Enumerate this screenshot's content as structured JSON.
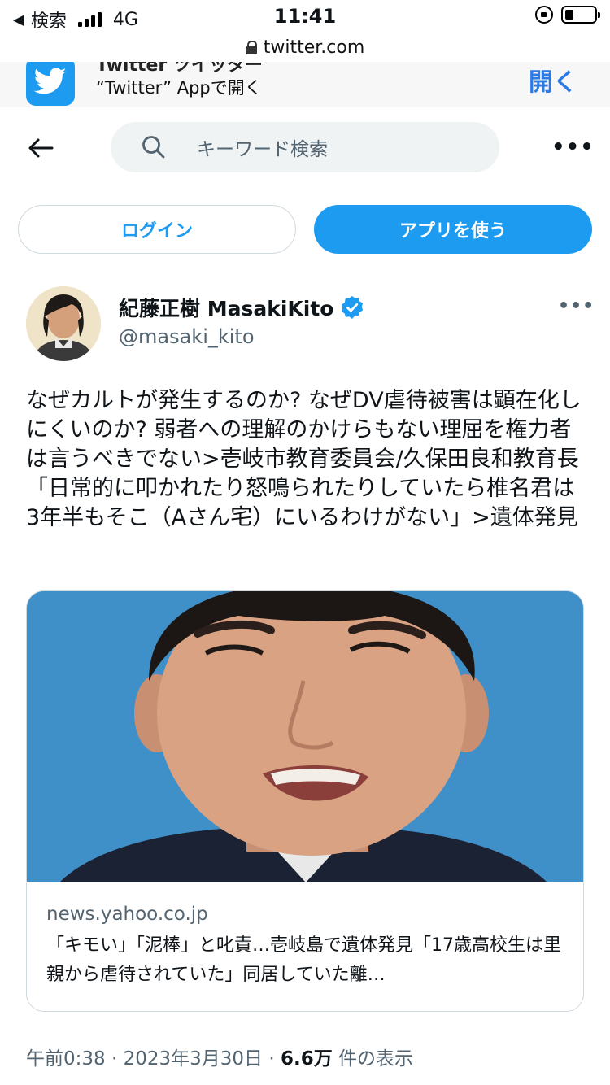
{
  "status_bar": {
    "back_label": "検索",
    "carrier": "4G",
    "time": "11:41"
  },
  "browser": {
    "url": "twitter.com"
  },
  "app_banner": {
    "title": "Twitter ツイッター",
    "subtitle": "“Twitter” Appで開く",
    "open_label": "開く"
  },
  "search": {
    "placeholder": "キーワード検索"
  },
  "actions": {
    "login_label": "ログイン",
    "use_app_label": "アプリを使う"
  },
  "tweet": {
    "author_name": "紀藤正樹 MasakiKito",
    "handle": "@masaki_kito",
    "text": "なぜカルトが発生するのか? なぜDV虐待被害は顕在化しにくいのか? 弱者への理解のかけらもない理屈を権力者は言うべきでない>壱岐市教育委員会/久保田良和教育長「日常的に叩かれたり怒鳴られたりしていたら椎名君は3年半もそこ（Aさん宅）にいるわけがない」>遺体発見",
    "card": {
      "domain": "news.yahoo.co.jp",
      "title": "「キモい」「泥棒」と叱責…壱岐島で遺体発見「17歳高校生は里親から虐待されていた」同居していた離…"
    },
    "time": "午前0:38",
    "date": "2023年3月30日",
    "views_count": "6.6万",
    "views_label": "件の表示"
  },
  "colors": {
    "accent": "#1d9bf0",
    "text": "#0f1419",
    "secondary": "#536471"
  }
}
